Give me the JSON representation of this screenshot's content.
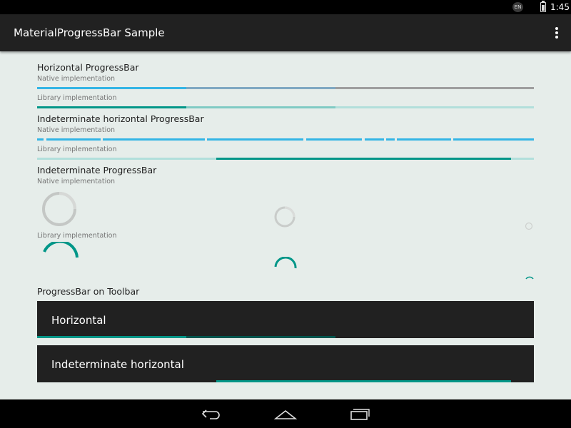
{
  "status_bar": {
    "language": "EN",
    "clock": "1:45"
  },
  "app_bar": {
    "title": "MaterialProgressBar Sample"
  },
  "sections": {
    "horizontal": {
      "title": "Horizontal ProgressBar",
      "native_label": "Native implementation",
      "library_label": "Library implementation",
      "progress": 0.3,
      "secondary_progress": 0.6
    },
    "indeterminate_horizontal": {
      "title": "Indeterminate horizontal ProgressBar",
      "native_label": "Native implementation",
      "library_label": "Library implementation"
    },
    "indeterminate": {
      "title": "Indeterminate ProgressBar",
      "native_label": "Native implementation",
      "library_label": "Library implementation"
    },
    "toolbar": {
      "title": "ProgressBar on Toolbar",
      "horizontal_title": "Horizontal",
      "indeterminate_title": "Indeterminate horizontal",
      "progress": 0.3,
      "secondary_progress": 0.6
    }
  },
  "colors": {
    "native_progress": "#33B5E5",
    "native_secondary": "#7FA8C2",
    "native_track": "#9E9E9E",
    "library_progress": "#009688",
    "library_secondary": "#80CBC4",
    "library_track": "#B2DFDB",
    "toolbar_bg": "#212121",
    "background": "#E6EDEA"
  },
  "icons": {
    "overflow": "overflow-menu-icon",
    "back": "back-icon",
    "home": "home-icon",
    "recents": "recents-icon",
    "battery": "battery-charging-icon",
    "language": "language-badge-icon"
  }
}
